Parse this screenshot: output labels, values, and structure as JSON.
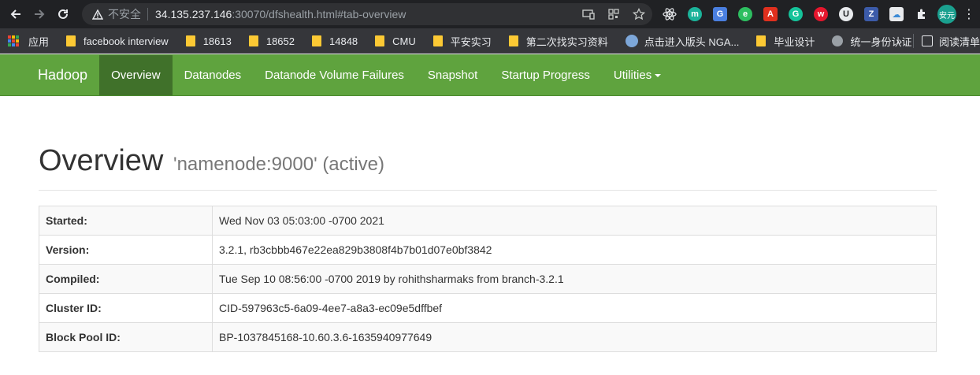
{
  "browser": {
    "insecure_label": "不安全",
    "url_host": "34.135.237.146",
    "url_rest": ":30070/dfshealth.html#tab-overview",
    "profile_label": "安元",
    "accent": "#202124"
  },
  "bookmarks": {
    "items": [
      {
        "label": "应用",
        "icon": "apps-grid-icon"
      },
      {
        "label": "facebook interview",
        "icon": "folder-icon"
      },
      {
        "label": "18613",
        "icon": "folder-icon"
      },
      {
        "label": "18652",
        "icon": "folder-icon"
      },
      {
        "label": "14848",
        "icon": "folder-icon"
      },
      {
        "label": "CMU",
        "icon": "folder-icon"
      },
      {
        "label": "平安实习",
        "icon": "folder-icon"
      },
      {
        "label": "第二次找实习资料",
        "icon": "folder-icon"
      },
      {
        "label": "点击进入版头 NGA...",
        "icon": "nga-icon"
      },
      {
        "label": "毕业设计",
        "icon": "folder-icon"
      },
      {
        "label": "统一身份认证",
        "icon": "globe-icon"
      }
    ],
    "more": "»",
    "reading_list": "阅读清单"
  },
  "navbar": {
    "brand": "Hadoop",
    "items": [
      {
        "label": "Overview",
        "active": true
      },
      {
        "label": "Datanodes",
        "active": false
      },
      {
        "label": "Datanode Volume Failures",
        "active": false
      },
      {
        "label": "Snapshot",
        "active": false
      },
      {
        "label": "Startup Progress",
        "active": false
      },
      {
        "label": "Utilities",
        "active": false,
        "dropdown": true
      }
    ],
    "color": "#5fa33e",
    "active_color": "#40712a"
  },
  "page": {
    "title": "Overview",
    "subtitle": "'namenode:9000' (active)"
  },
  "overview_table": [
    {
      "key": "Started:",
      "value": "Wed Nov 03 05:03:00 -0700 2021"
    },
    {
      "key": "Version:",
      "value": "3.2.1, rb3cbbb467e22ea829b3808f4b7b01d07e0bf3842"
    },
    {
      "key": "Compiled:",
      "value": "Tue Sep 10 08:56:00 -0700 2019 by rohithsharmaks from branch-3.2.1"
    },
    {
      "key": "Cluster ID:",
      "value": "CID-597963c5-6a09-4ee7-a8a3-ec09e5dffbef"
    },
    {
      "key": "Block Pool ID:",
      "value": "BP-1037845168-10.60.3.6-1635940977649"
    }
  ]
}
